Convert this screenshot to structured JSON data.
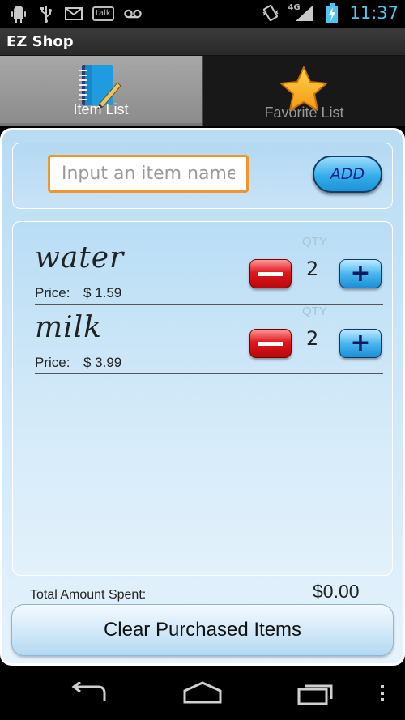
{
  "status_bar": {
    "icons": [
      "android-debug-icon",
      "usb-icon",
      "gmail-icon",
      "talk-icon",
      "voicemail-icon",
      "vibrate-icon",
      "signal-4g-icon",
      "battery-charging-icon"
    ],
    "talk_label": "talk",
    "network": "4G",
    "time": "11:37"
  },
  "app": {
    "title": "EZ Shop"
  },
  "tabs": [
    {
      "label": "Item List",
      "icon": "notebook-icon",
      "active": true
    },
    {
      "label": "Favorite List",
      "icon": "star-icon",
      "active": false
    }
  ],
  "input": {
    "placeholder": "Input an item name",
    "value": "",
    "add_label": "ADD"
  },
  "list": {
    "qty_header": "QTY",
    "price_label": "Price:",
    "items": [
      {
        "name": "water",
        "price": "$ 1.59",
        "qty": "2"
      },
      {
        "name": "milk",
        "price": "$ 3.99",
        "qty": "2"
      }
    ]
  },
  "totals": {
    "label": "Total Amount Spent:",
    "value": "$0.00"
  },
  "clear_button": "Clear Purchased Items",
  "nav": {
    "icons": [
      "back-icon",
      "home-icon",
      "recent-apps-icon",
      "overflow-menu-icon"
    ]
  },
  "colors": {
    "status_time": "#4fc6f2",
    "input_border": "#f0962c",
    "panel_blue": "#b9dcf3",
    "minus_red": "#e0171c",
    "plus_blue": "#48b6f0"
  }
}
